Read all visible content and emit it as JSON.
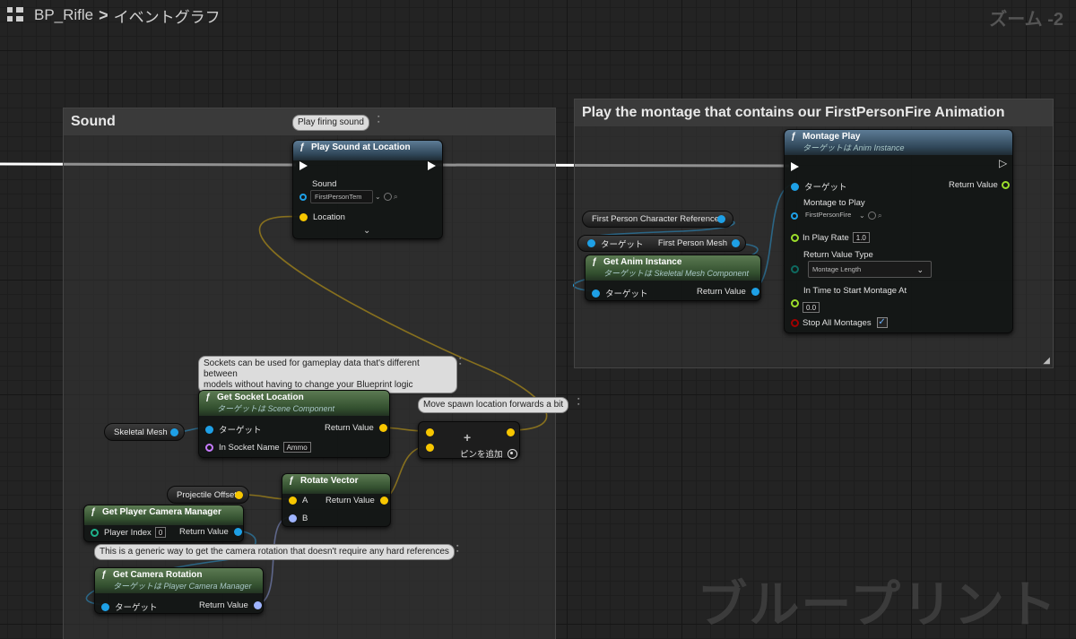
{
  "breadcrumb": {
    "blueprint": "BP_Rifle",
    "separator": ">",
    "graph": "イベントグラフ"
  },
  "zoom": "ズーム -2",
  "watermark": "ブループリント",
  "comments": {
    "sound": "Sound",
    "montage": "Play the montage that contains our FirstPersonFire Animation"
  },
  "bubbles": {
    "play_sound": "Play firing sound",
    "sockets_line1": "Sockets can be used for gameplay data that's different between",
    "sockets_line2": "models without having to change your Blueprint logic",
    "move_spawn": "Move spawn location forwards a bit",
    "camera": "This is a generic way to get the camera rotation that doesn't require any hard references"
  },
  "nodes": {
    "play_sound": {
      "title": "Play Sound at Location",
      "sound_label": "Sound",
      "sound_value": "FirstPersonTem",
      "location": "Location"
    },
    "montage_play": {
      "title": "Montage Play",
      "subtitle": "ターゲットは Anim Instance",
      "target": "ターゲット",
      "return_value": "Return Value",
      "montage_to_play": "Montage to Play",
      "montage_value": "FirstPersonFire",
      "in_play_rate": "In Play Rate",
      "in_play_rate_value": "1.0",
      "return_value_type": "Return Value Type",
      "return_value_type_value": "Montage Length",
      "in_time": "In Time to Start Montage At",
      "in_time_value": "0.0",
      "stop_all": "Stop All Montages"
    },
    "first_person_ref": "First Person Character Reference",
    "fp_mesh": {
      "target": "ターゲット",
      "output": "First Person Mesh"
    },
    "get_anim": {
      "title": "Get Anim Instance",
      "subtitle": "ターゲットは Skeletal Mesh Component",
      "target": "ターゲット",
      "return_value": "Return Value"
    },
    "get_socket": {
      "title": "Get Socket Location",
      "subtitle": "ターゲットは Scene Component",
      "target": "ターゲット",
      "return_value": "Return Value",
      "socket_name": "In Socket Name",
      "socket_value": "Ammo"
    },
    "skeletal_mesh": "Skeletal Mesh",
    "add": {
      "plus": "+",
      "label": "ピンを追加"
    },
    "projectile_offset": "Projectile Offset",
    "rotate": {
      "title": "Rotate Vector",
      "a": "A",
      "b": "B",
      "return_value": "Return Value"
    },
    "camera_manager": {
      "title": "Get Player Camera Manager",
      "player_index": "Player Index",
      "player_index_value": "0",
      "return_value": "Return Value"
    },
    "camera_rotation": {
      "title": "Get Camera Rotation",
      "subtitle": "ターゲットは Player Camera Manager",
      "target": "ターゲット",
      "return_value": "Return Value"
    }
  },
  "colors": {
    "exec": "#ffffff",
    "object": "#00a8f2",
    "vector": "#f7c600",
    "rotator": "#9fb4ff",
    "float": "#9cde2b",
    "name": "#c77bff",
    "enum": "#0e6a60",
    "bool": "#a00000"
  }
}
